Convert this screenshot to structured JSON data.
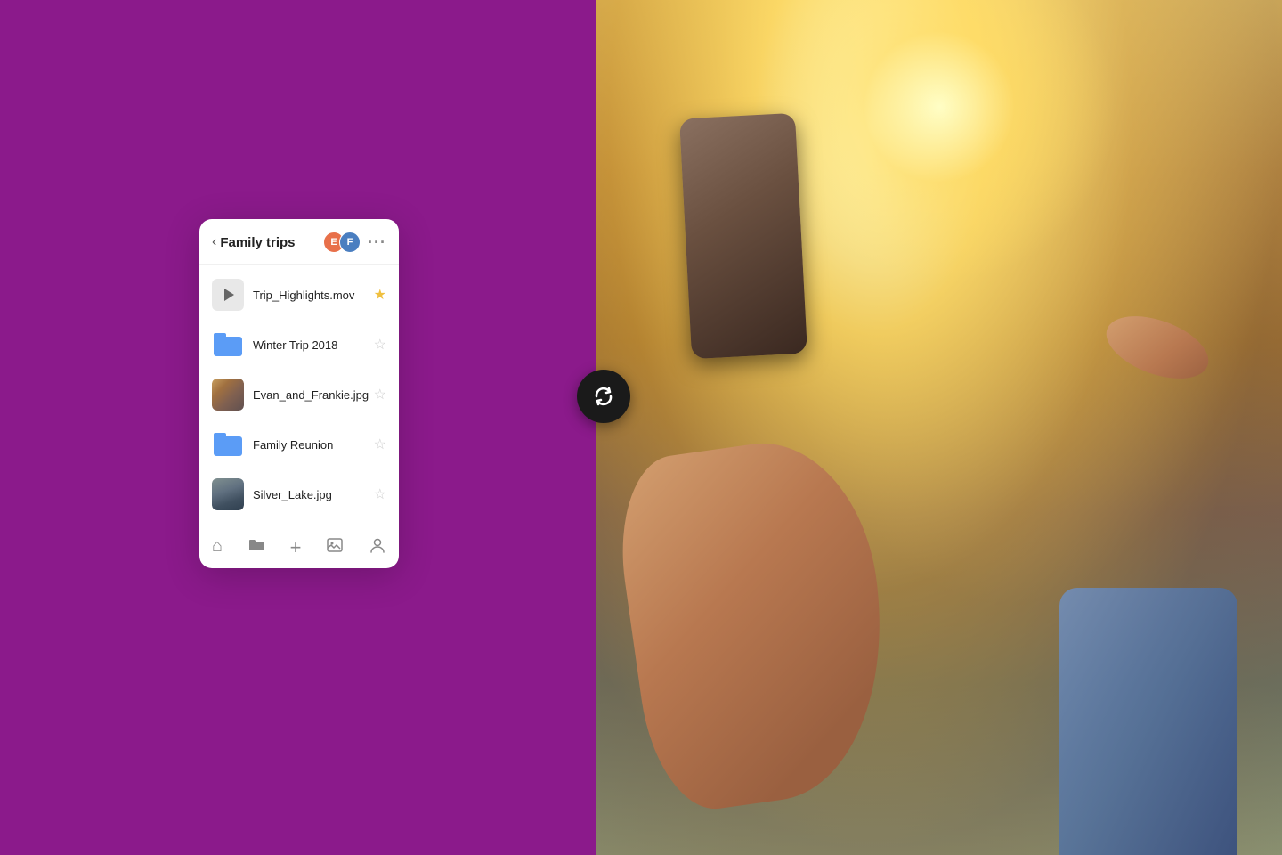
{
  "layout": {
    "left_bg": "#8B1A8B",
    "right_bg": "photo"
  },
  "header": {
    "back_label": "‹",
    "title": "Family trips",
    "more_label": "···",
    "avatar1_initials": "E",
    "avatar2_initials": "F"
  },
  "files": [
    {
      "id": "file-1",
      "name": "Trip_Highlights.mov",
      "type": "video",
      "starred": true
    },
    {
      "id": "file-2",
      "name": "Winter Trip 2018",
      "type": "folder",
      "starred": false
    },
    {
      "id": "file-3",
      "name": "Evan_and_Frankie.jpg",
      "type": "photo-evan",
      "starred": false
    },
    {
      "id": "file-4",
      "name": "Family Reunion",
      "type": "folder",
      "starred": false
    },
    {
      "id": "file-5",
      "name": "Silver_Lake.jpg",
      "type": "photo-silver",
      "starred": false
    }
  ],
  "bottom_nav": {
    "items": [
      {
        "id": "home",
        "icon": "⌂",
        "label": "home"
      },
      {
        "id": "files",
        "icon": "🗂",
        "label": "files"
      },
      {
        "id": "add",
        "icon": "+",
        "label": "add"
      },
      {
        "id": "photos",
        "icon": "🖼",
        "label": "photos"
      },
      {
        "id": "account",
        "icon": "👤",
        "label": "account"
      }
    ]
  },
  "sync_button": {
    "label": "sync"
  }
}
